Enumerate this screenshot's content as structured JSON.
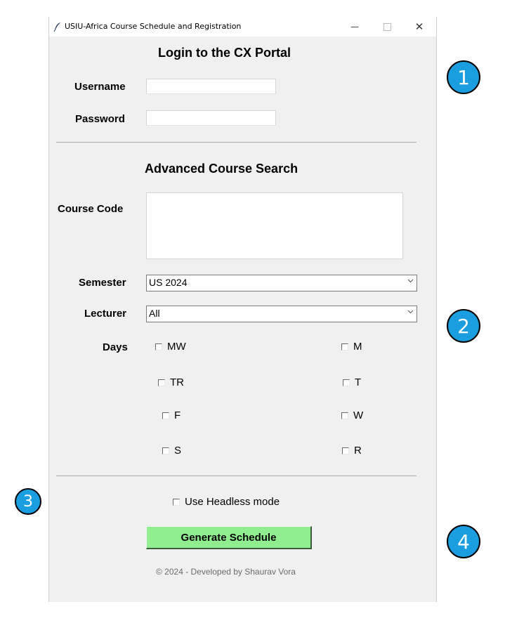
{
  "window": {
    "title": "USIU-Africa Course Schedule and Registration",
    "controls": {
      "minimize": "—",
      "close": "✕"
    }
  },
  "login": {
    "heading": "Login to the CX Portal",
    "username_label": "Username",
    "username_value": "",
    "password_label": "Password",
    "password_value": ""
  },
  "search": {
    "heading": "Advanced Course Search",
    "course_code_label": "Course Code",
    "course_code_value": "",
    "semester_label": "Semester",
    "semester_value": "US 2024",
    "lecturer_label": "Lecturer",
    "lecturer_value": "All",
    "days_label": "Days",
    "days": [
      {
        "label": "MW",
        "checked": false
      },
      {
        "label": "M",
        "checked": false
      },
      {
        "label": "TR",
        "checked": false
      },
      {
        "label": "T",
        "checked": false
      },
      {
        "label": "F",
        "checked": false
      },
      {
        "label": "W",
        "checked": false
      },
      {
        "label": "S",
        "checked": false
      },
      {
        "label": "R",
        "checked": false
      }
    ]
  },
  "options": {
    "headless_label": "Use Headless mode",
    "headless_checked": false
  },
  "actions": {
    "generate_label": "Generate Schedule"
  },
  "footer": {
    "text": "©   2024 - Developed by Shaurav Vora"
  },
  "annotations": {
    "badge_1": "1",
    "badge_2": "2",
    "badge_3": "3",
    "badge_4": "4",
    "badge_color": "#1a9ee0"
  }
}
